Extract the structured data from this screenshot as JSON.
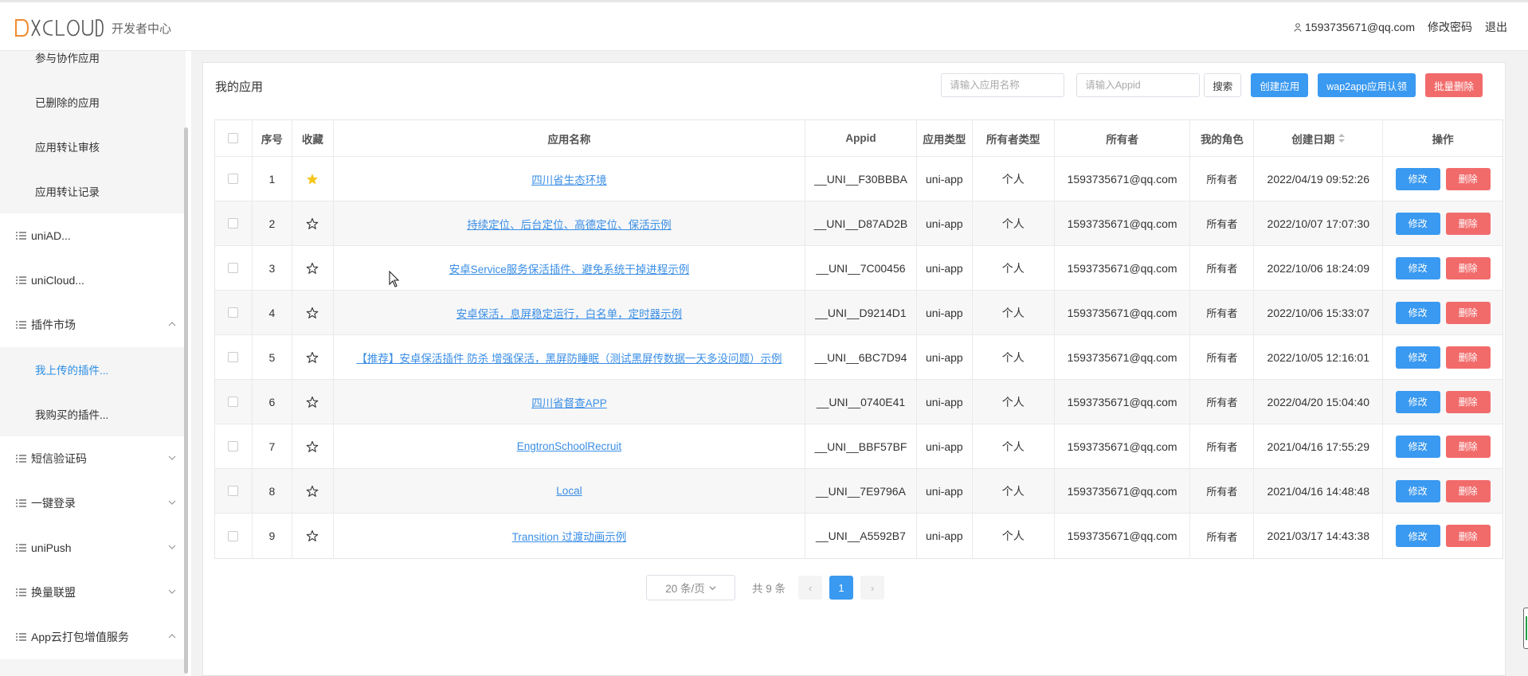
{
  "header": {
    "logo_text": "DCLOUD",
    "subtitle": "开发者中心",
    "user_email": "1593735671@qq.com",
    "change_password": "修改密码",
    "logout": "退出"
  },
  "sidebar": {
    "items": [
      {
        "label": "参与协作应用",
        "type": "sub",
        "active": false
      },
      {
        "label": "已删除的应用",
        "type": "sub",
        "active": false
      },
      {
        "label": "应用转让审核",
        "type": "sub",
        "active": false
      },
      {
        "label": "应用转让记录",
        "type": "sub",
        "active": false
      },
      {
        "label": "uniAD...",
        "type": "top",
        "chevron": "none"
      },
      {
        "label": "uniCloud...",
        "type": "top",
        "chevron": "none"
      },
      {
        "label": "插件市场",
        "type": "top",
        "chevron": "up"
      },
      {
        "label": "我上传的插件...",
        "type": "sub",
        "active": true
      },
      {
        "label": "我购买的插件...",
        "type": "sub",
        "active": false
      },
      {
        "label": "短信验证码",
        "type": "top",
        "chevron": "down"
      },
      {
        "label": "一键登录",
        "type": "top",
        "chevron": "down"
      },
      {
        "label": "uniPush",
        "type": "top",
        "chevron": "down"
      },
      {
        "label": "换量联盟",
        "type": "top",
        "chevron": "down"
      },
      {
        "label": "App云打包增值服务",
        "type": "top",
        "chevron": "up"
      }
    ]
  },
  "main": {
    "title": "我的应用",
    "search_name_placeholder": "请输入应用名称",
    "search_appid_placeholder": "请输入Appid",
    "search_button": "搜索",
    "create_button": "创建应用",
    "wap2app_button": "wap2app应用认领",
    "batch_delete_button": "批量删除",
    "columns": [
      "序号",
      "收藏",
      "应用名称",
      "Appid",
      "应用类型",
      "所有者类型",
      "所有者",
      "我的角色",
      "创建日期",
      "操作"
    ],
    "rows": [
      {
        "no": "1",
        "starred": true,
        "name": "四川省生态环境",
        "appid": "__UNI__F30BBBA",
        "type": "uni-app",
        "owner_type": "个人",
        "owner": "1593735671@qq.com",
        "role": "所有者",
        "date": "2022/04/19 09:52:26"
      },
      {
        "no": "2",
        "starred": false,
        "name": "持续定位、后台定位、高德定位、保活示例",
        "appid": "__UNI__D87AD2B",
        "type": "uni-app",
        "owner_type": "个人",
        "owner": "1593735671@qq.com",
        "role": "所有者",
        "date": "2022/10/07 17:07:30"
      },
      {
        "no": "3",
        "starred": false,
        "name": "安卓Service服务保活插件、避免系统干掉进程示例",
        "appid": "__UNI__7C00456",
        "type": "uni-app",
        "owner_type": "个人",
        "owner": "1593735671@qq.com",
        "role": "所有者",
        "date": "2022/10/06 18:24:09"
      },
      {
        "no": "4",
        "starred": false,
        "name": "安卓保活，息屏稳定运行，白名单，定时器示例",
        "appid": "__UNI__D9214D1",
        "type": "uni-app",
        "owner_type": "个人",
        "owner": "1593735671@qq.com",
        "role": "所有者",
        "date": "2022/10/06 15:33:07"
      },
      {
        "no": "5",
        "starred": false,
        "name": "【推荐】安卓保活插件 防杀 增强保活，黑屏防睡眠（测试黑屏传数据一天多没问题）示例",
        "appid": "__UNI__6BC7D94",
        "type": "uni-app",
        "owner_type": "个人",
        "owner": "1593735671@qq.com",
        "role": "所有者",
        "date": "2022/10/05 12:16:01"
      },
      {
        "no": "6",
        "starred": false,
        "name": "四川省督查APP",
        "appid": "__UNI__0740E41",
        "type": "uni-app",
        "owner_type": "个人",
        "owner": "1593735671@qq.com",
        "role": "所有者",
        "date": "2022/04/20 15:04:40"
      },
      {
        "no": "7",
        "starred": false,
        "name": "EngtronSchoolRecruit",
        "appid": "__UNI__BBF57BF",
        "type": "uni-app",
        "owner_type": "个人",
        "owner": "1593735671@qq.com",
        "role": "所有者",
        "date": "2021/04/16 17:55:29"
      },
      {
        "no": "8",
        "starred": false,
        "name": "Local",
        "appid": "__UNI__7E9796A",
        "type": "uni-app",
        "owner_type": "个人",
        "owner": "1593735671@qq.com",
        "role": "所有者",
        "date": "2021/04/16 14:48:48"
      },
      {
        "no": "9",
        "starred": false,
        "name": "Transition 过渡动画示例",
        "appid": "__UNI__A5592B7",
        "type": "uni-app",
        "owner_type": "个人",
        "owner": "1593735671@qq.com",
        "role": "所有者",
        "date": "2021/03/17 14:43:38"
      }
    ],
    "edit_label": "修改",
    "delete_label": "删除",
    "pagination": {
      "page_size": "20 条/页",
      "total": "共 9 条",
      "current_page": "1",
      "prev": "‹",
      "next": "›"
    }
  },
  "colors": {
    "primary": "#3a99f0",
    "danger": "#f26b6b",
    "link": "#3a8ee6",
    "star": "#f5c518"
  }
}
